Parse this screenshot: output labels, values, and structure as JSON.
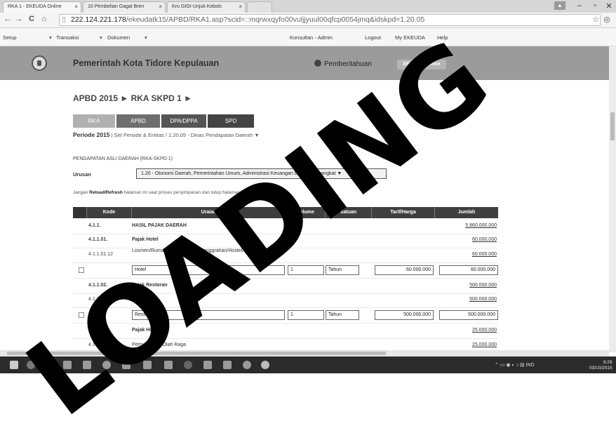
{
  "browser": {
    "tabs": [
      {
        "label": "RKA 1 - EKEUDA Online"
      },
      {
        "label": "10 Pembelian Gagal Bren"
      },
      {
        "label": "Kru GIGI-Unjuk Kebolc"
      }
    ],
    "url_host": "222.124.221.178",
    "url_path": "/ekeudatk15/APBD/RKA1.asp?scid=::mqrwxqyfo00vuljjyuul00qfcp0054jmq&idskpd=1.20.05"
  },
  "menu": {
    "items": [
      "Setup",
      "Transaksi",
      "Dokumen"
    ],
    "right_items": [
      "Konsultan - Admin",
      "Logout",
      "My EKEUDA",
      "Help"
    ]
  },
  "header": {
    "org_name": "Pemerintah Kota Tidore Kepulauan",
    "notification": "Pemberitahuan",
    "badge": "EKEUDA Online"
  },
  "breadcrumb": "APBD 2015 ► RKA SKPD 1 ►",
  "tabs": [
    "RKA",
    "APBD",
    "DPA/DPPA",
    "SPD"
  ],
  "period": {
    "label": "Periode 2015",
    "detail": "| Set Periode & Entitas / 1.20.05 - Dinas Pendapatan Daerah ▼"
  },
  "section_title": "PENDAPATAN ASLI DAERAH (RKA-SKPD 1)",
  "urusan": {
    "label": "Urusan",
    "selected": "1.20 - Otonomi Daerah, Pemerintahan Umum, Administrasi Keuangan Daerah, Perangkat ▼"
  },
  "warning": {
    "prefix": "Jangan",
    "bold": "Reload/Refresh",
    "suffix": "halaman ini saat proses penyimpanan dan tutup halaman ini jika lambat !"
  },
  "table": {
    "headers": [
      "Kode",
      "Uraian",
      "Volume",
      "Satuan",
      "Tarif/Harga",
      "Jumlah"
    ],
    "rows": [
      {
        "code": "4.1.1.",
        "desc": "HASIL PAJAK DAERAH",
        "amount": "5.860.000.000",
        "bold": true
      },
      {
        "code": "4.1.1.01.",
        "desc": "Pajak Hotel",
        "amount": "60.000.000",
        "bold": true
      },
      {
        "code": "4.1.1.01.12",
        "desc": "Losmen/Rumah penginapan/Pesanggrahan/Hostel/Rumah Kos",
        "amount": "60.000.000",
        "bold": false
      },
      {
        "input": true,
        "desc": "Hotel",
        "volume": "1",
        "unit": "Tahun",
        "price": "60.000.000",
        "total": "60.000.000"
      },
      {
        "code": "4.1.1.02.",
        "desc": "Pajak Restoran",
        "amount": "500.000.000",
        "bold": true
      },
      {
        "code": "4.1.1.02.01",
        "desc": "Restoran",
        "amount": "500.000.000",
        "bold": false
      },
      {
        "input": true,
        "desc": "Restoran",
        "volume": "1",
        "unit": "Tahun",
        "price": "500.000.000",
        "total": "500.000.000"
      },
      {
        "code": "4.1.1.03.",
        "desc": "Pajak Hiburan",
        "amount": "25.000.000",
        "bold": true
      },
      {
        "code": "4.1.1.03.19",
        "desc": "Pertandingan Olah Raga",
        "amount": "25.000.000",
        "bold": false
      }
    ]
  },
  "taskbar": {
    "tray": "IND",
    "time": "9:29",
    "date": "03/10/2015"
  },
  "watermark": "LOADING"
}
